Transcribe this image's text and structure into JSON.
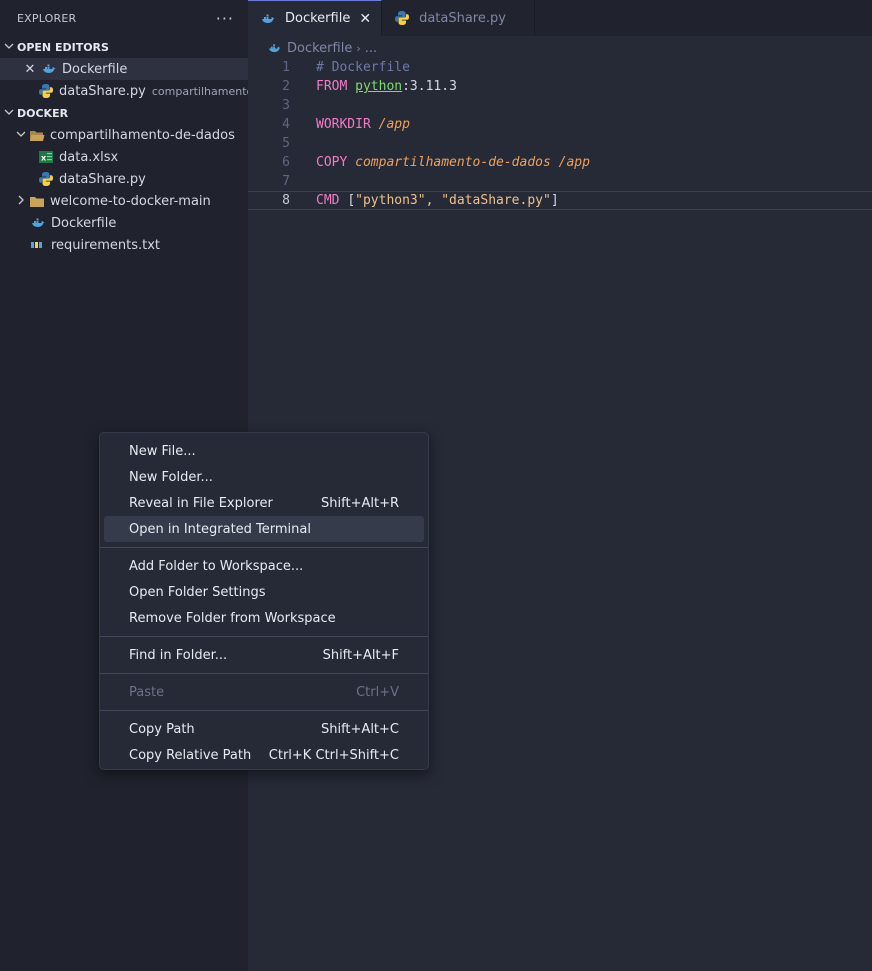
{
  "sidebar": {
    "title": "EXPLORER",
    "more": "···",
    "open_editors": {
      "label": "OPEN EDITORS",
      "items": [
        {
          "name": "Dockerfile",
          "desc": ""
        },
        {
          "name": "dataShare.py",
          "desc": "compartilhamento..."
        }
      ]
    },
    "docker": {
      "label": "DOCKER",
      "items": [
        {
          "name": "compartilhamento-de-dados"
        },
        {
          "name": "data.xlsx"
        },
        {
          "name": "dataShare.py"
        },
        {
          "name": "welcome-to-docker-main"
        },
        {
          "name": "Dockerfile"
        },
        {
          "name": "requirements.txt"
        }
      ]
    }
  },
  "tabs": [
    {
      "label": "Dockerfile",
      "close": "✕"
    },
    {
      "label": "dataShare.py"
    }
  ],
  "breadcrumb": {
    "file": "Dockerfile",
    "sep": "›",
    "more": "..."
  },
  "editor": {
    "lines": [
      {
        "num": "1",
        "t0": "# Dockerfile"
      },
      {
        "num": "2",
        "t0": "FROM",
        "t1": "python",
        "t2": ":3.11.3"
      },
      {
        "num": "3"
      },
      {
        "num": "4",
        "t0": "WORKDIR",
        "t1": "/app"
      },
      {
        "num": "5"
      },
      {
        "num": "6",
        "t0": "COPY",
        "t1": "compartilhamento-de-dados /app"
      },
      {
        "num": "7"
      },
      {
        "num": "8",
        "t0": "CMD",
        "t1": "[",
        "t2": "\"python3\", \"dataShare.py\"",
        "t3": "]"
      }
    ]
  },
  "context_menu": {
    "items": [
      {
        "label": "New File...",
        "shortcut": ""
      },
      {
        "label": "New Folder...",
        "shortcut": ""
      },
      {
        "label": "Reveal in File Explorer",
        "shortcut": "Shift+Alt+R"
      },
      {
        "label": "Open in Integrated Terminal",
        "shortcut": ""
      },
      {
        "label": "Add Folder to Workspace...",
        "shortcut": ""
      },
      {
        "label": "Open Folder Settings",
        "shortcut": ""
      },
      {
        "label": "Remove Folder from Workspace",
        "shortcut": ""
      },
      {
        "label": "Find in Folder...",
        "shortcut": "Shift+Alt+F"
      },
      {
        "label": "Paste",
        "shortcut": "Ctrl+V"
      },
      {
        "label": "Copy Path",
        "shortcut": "Shift+Alt+C"
      },
      {
        "label": "Copy Relative Path",
        "shortcut": "Ctrl+K Ctrl+Shift+C"
      }
    ]
  },
  "colors": {
    "docker_blue": "#4fa3e0",
    "python_blue": "#3b77b0",
    "python_yellow": "#f6d147",
    "excel_green": "#1d7a45",
    "folder": "#c9a35a"
  },
  "icons": {
    "docker": "whale-icon",
    "python": "python-icon",
    "excel": "excel-icon",
    "folder": "folder-icon",
    "text": "text-file-icon"
  }
}
